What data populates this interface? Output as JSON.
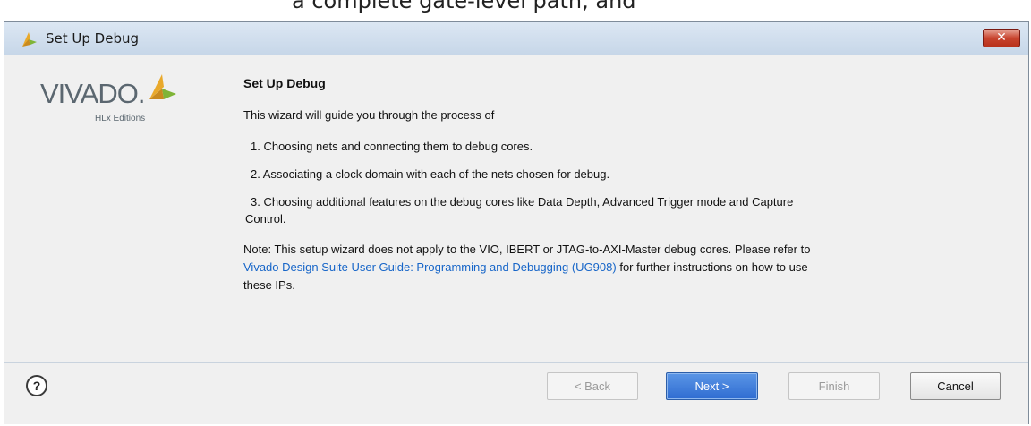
{
  "top_strip": {
    "text": "a complete gate-level path, and"
  },
  "window": {
    "title": "Set Up Debug",
    "close_glyph": "✕"
  },
  "logo": {
    "word": "VIVADO.",
    "sub": "HLx Editions"
  },
  "main": {
    "heading": "Set Up Debug",
    "intro": "This wizard will guide you through the process of",
    "steps": [
      "1. Choosing nets and connecting them to debug cores.",
      "2. Associating a clock domain with each of the nets chosen for debug.",
      "3. Choosing additional features on the debug cores like Data Depth, Advanced Trigger mode and Capture",
      "Control."
    ],
    "note": {
      "line1": "Note: This setup wizard does not apply to the VIO, IBERT or JTAG-to-AXI-Master debug cores. Please refer to",
      "link": "Vivado Design Suite User Guide: Programming and Debugging (UG908)",
      "after_link": " for further instructions on how to use",
      "line3": "these IPs."
    }
  },
  "footer": {
    "help_glyph": "?",
    "back_label": "< Back",
    "next_label": "Next >",
    "finish_label": "Finish",
    "cancel_label": "Cancel"
  },
  "colors": {
    "accent": "#2f6cd1",
    "link": "#1665c8",
    "close": "#c8452f",
    "logo_leaf": "#e9a92b"
  },
  "icons": {
    "title": "vivado-leaf-icon",
    "help": "help-icon",
    "close": "close-icon"
  }
}
